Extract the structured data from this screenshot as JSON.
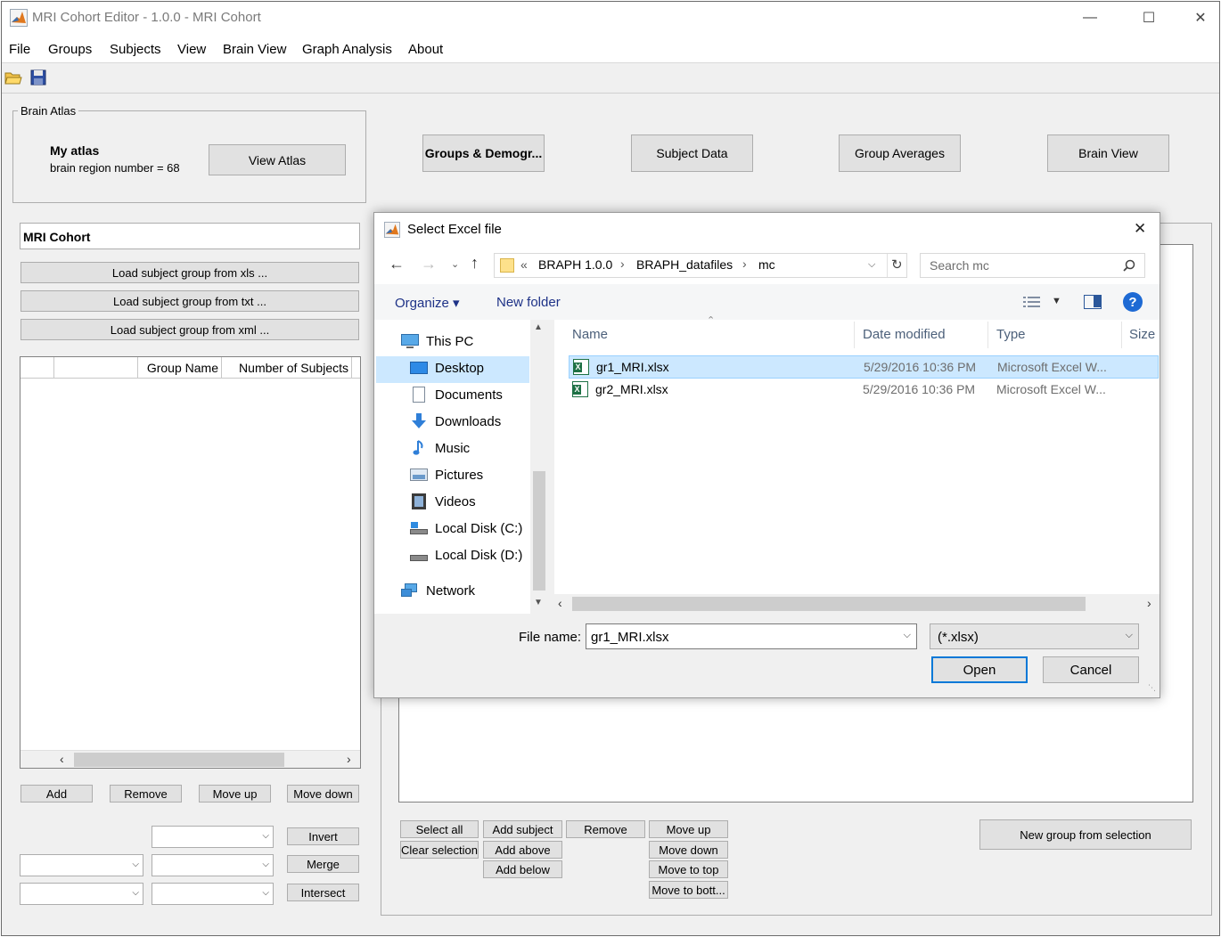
{
  "window": {
    "title": "MRI Cohort Editor - 1.0.0 - MRI Cohort",
    "minimize_icon": "—",
    "maximize_icon": "☐",
    "close_icon": "✕"
  },
  "menu": [
    "File",
    "Groups",
    "Subjects",
    "View",
    "Brain View",
    "Graph Analysis",
    "About"
  ],
  "toolbar": {
    "open_icon": "open-folder-icon",
    "save_icon": "save-disk-icon"
  },
  "brain_atlas": {
    "legend": "Brain Atlas",
    "atlas_name": "My atlas",
    "region_text": "brain region number = 68",
    "view_button": "View Atlas"
  },
  "tabs": [
    "Groups & Demogr...",
    "Subject Data",
    "Group Averages",
    "Brain View"
  ],
  "cohort": {
    "name": "MRI Cohort",
    "load_xls": "Load subject group from xls ...",
    "load_txt": "Load subject group from txt ...",
    "load_xml": "Load subject group from xml ...",
    "columns": [
      "",
      "",
      "Group Name",
      "Number of Subjects"
    ],
    "buttons": {
      "add": "Add",
      "remove": "Remove",
      "move_up": "Move up",
      "move_down": "Move down"
    },
    "ops": {
      "invert": "Invert",
      "merge": "Merge",
      "intersect": "Intersect"
    }
  },
  "subjects_panel": {
    "select_all": "Select all",
    "clear_selection": "Clear selection",
    "add_subject": "Add subject",
    "add_above": "Add above",
    "add_below": "Add below",
    "remove": "Remove",
    "move_up": "Move up",
    "move_down": "Move down",
    "move_to_top": "Move to top",
    "move_to_bottom": "Move to bott...",
    "new_group": "New group from selection"
  },
  "dialog": {
    "title": "Select Excel file",
    "close_icon": "✕",
    "breadcrumb_prefix": "«",
    "breadcrumb": [
      "BRAPH 1.0.0",
      "BRAPH_datafiles",
      "mc"
    ],
    "breadcrumb_sep": "›",
    "search_placeholder": "Search mc",
    "organize": "Organize ▾",
    "new_folder": "New folder",
    "help_glyph": "?",
    "nav_items": [
      {
        "label": "This PC"
      },
      {
        "label": "Desktop"
      },
      {
        "label": "Documents"
      },
      {
        "label": "Downloads"
      },
      {
        "label": "Music"
      },
      {
        "label": "Pictures"
      },
      {
        "label": "Videos"
      },
      {
        "label": "Local Disk (C:)"
      },
      {
        "label": "Local Disk (D:)"
      },
      {
        "label": "Network"
      }
    ],
    "columns": {
      "name": "Name",
      "date": "Date modified",
      "type": "Type",
      "size": "Size"
    },
    "files": [
      {
        "name": "gr1_MRI.xlsx",
        "date": "5/29/2016 10:36 PM",
        "type": "Microsoft Excel W...",
        "selected": true
      },
      {
        "name": "gr2_MRI.xlsx",
        "date": "5/29/2016 10:36 PM",
        "type": "Microsoft Excel W...",
        "selected": false
      }
    ],
    "file_name_label": "File name:",
    "file_name_value": "gr1_MRI.xlsx",
    "filter": "(*.xlsx)",
    "open": "Open",
    "cancel": "Cancel"
  }
}
